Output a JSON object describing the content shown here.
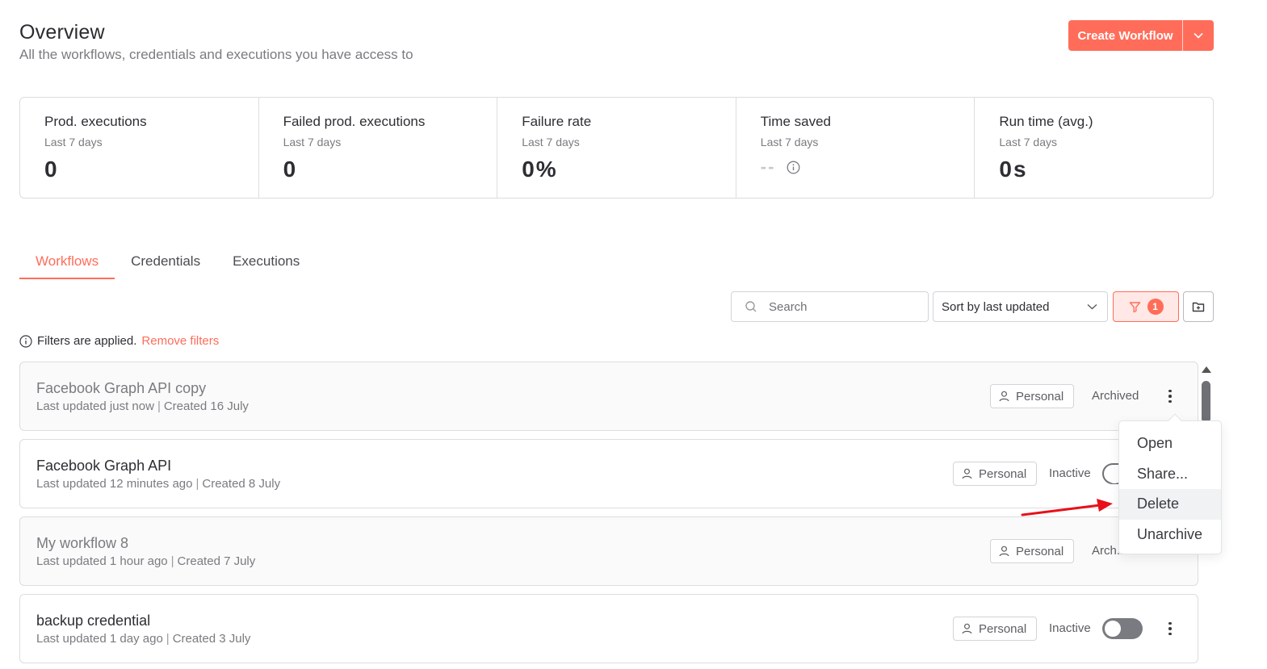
{
  "header": {
    "title": "Overview",
    "subtitle": "All the workflows, credentials and executions you have access to",
    "create_button": "Create Workflow"
  },
  "stats": [
    {
      "label": "Prod. executions",
      "period": "Last 7 days",
      "value": "0"
    },
    {
      "label": "Failed prod. executions",
      "period": "Last 7 days",
      "value": "0"
    },
    {
      "label": "Failure rate",
      "period": "Last 7 days",
      "value": "0%"
    },
    {
      "label": "Time saved",
      "period": "Last 7 days",
      "value": "--"
    },
    {
      "label": "Run time (avg.)",
      "period": "Last 7 days",
      "value": "0s"
    }
  ],
  "tabs": [
    "Workflows",
    "Credentials",
    "Executions"
  ],
  "toolbar": {
    "search_placeholder": "Search",
    "sort_label": "Sort by last updated",
    "filter_count": "1"
  },
  "filters_note": {
    "text": "Filters are applied.",
    "remove_link": "Remove filters"
  },
  "workflows": [
    {
      "name": "Facebook Graph API copy",
      "updated": "Last updated just now",
      "created": "Created 16 July",
      "owner": "Personal",
      "status": "Archived"
    },
    {
      "name": "Facebook Graph API",
      "updated": "Last updated 12 minutes ago",
      "created": "Created 8 July",
      "owner": "Personal",
      "status": "Inactive"
    },
    {
      "name": "My workflow 8",
      "updated": "Last updated 1 hour ago",
      "created": "Created 7 July",
      "owner": "Personal",
      "status": "Arch..."
    },
    {
      "name": "backup credential",
      "updated": "Last updated 1 day ago",
      "created": "Created 3 July",
      "owner": "Personal",
      "status": "Inactive"
    }
  ],
  "context_menu": {
    "items": [
      "Open",
      "Share...",
      "Delete",
      "Unarchive"
    ]
  },
  "colors": {
    "accent": "#ff6d5a",
    "annotation_arrow": "#e8101a"
  }
}
